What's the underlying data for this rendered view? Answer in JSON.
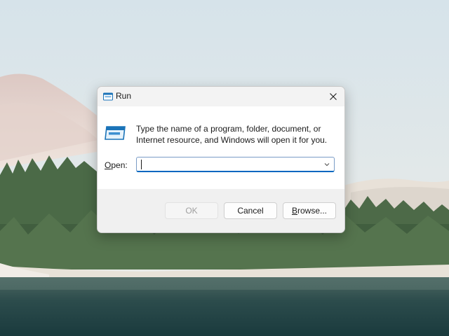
{
  "dialog": {
    "title": "Run",
    "description": "Type the name of a program, folder, document, or Internet resource, and Windows will open it for you.",
    "open_label_accel": "O",
    "open_label_rest": "pen:",
    "open_value": "",
    "ok_label": "OK",
    "cancel_label": "Cancel",
    "browse_label_accel": "B",
    "browse_label_rest": "rowse..."
  },
  "colors": {
    "accent": "#0067c0",
    "icon_blue": "#1a73b8"
  }
}
